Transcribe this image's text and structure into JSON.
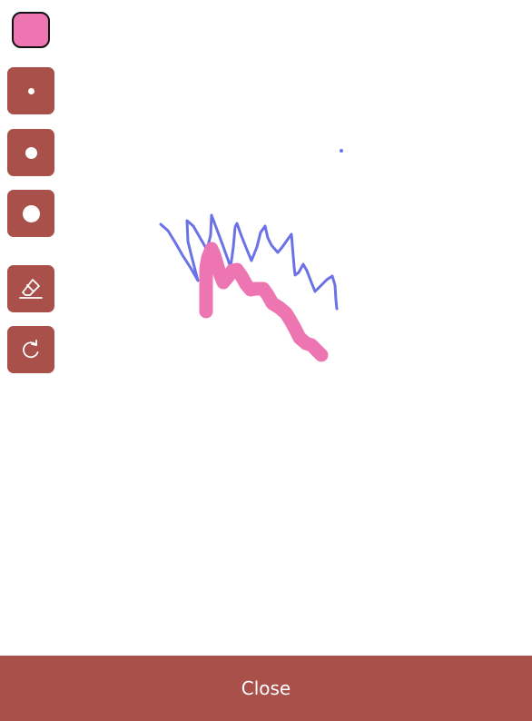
{
  "colors": {
    "selected_color": "#ec75b2",
    "tool_button_bg": "#a9504a",
    "stroke_blue": "#6b72e6",
    "stroke_pink": "#ec75b2"
  },
  "toolbar": {
    "color_swatch_icon": "color-picker",
    "small_brush_icon": "small-dot",
    "medium_brush_icon": "medium-dot",
    "large_brush_icon": "large-dot",
    "eraser_icon": "eraser",
    "redo_icon": "rotate-clockwise"
  },
  "footer": {
    "close_label": "Close"
  }
}
